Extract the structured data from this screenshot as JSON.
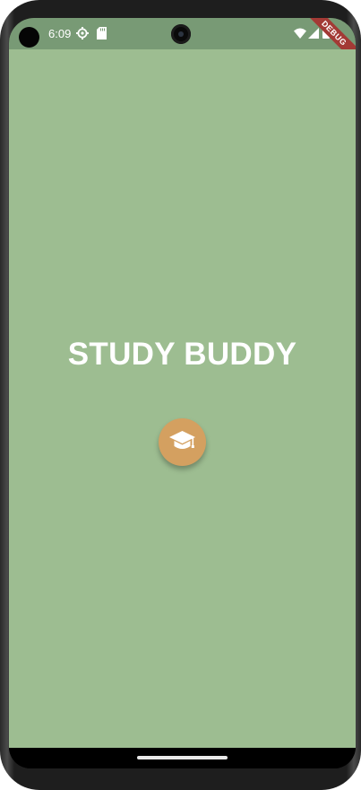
{
  "status_bar": {
    "time": "6:09",
    "icons": [
      "settings-gear-icon",
      "sd-card-icon",
      "wifi-icon",
      "cell-signal-icon",
      "battery-icon"
    ]
  },
  "debug_banner": {
    "label": "DEBUG",
    "color": "#a33a35"
  },
  "app": {
    "title": "STUDY BUDDY",
    "logo_icon": "graduation-cap-icon",
    "background_color": "#9dbd91",
    "accent_color": "#d4a060"
  },
  "nav": {
    "home_indicator": "home-indicator"
  }
}
